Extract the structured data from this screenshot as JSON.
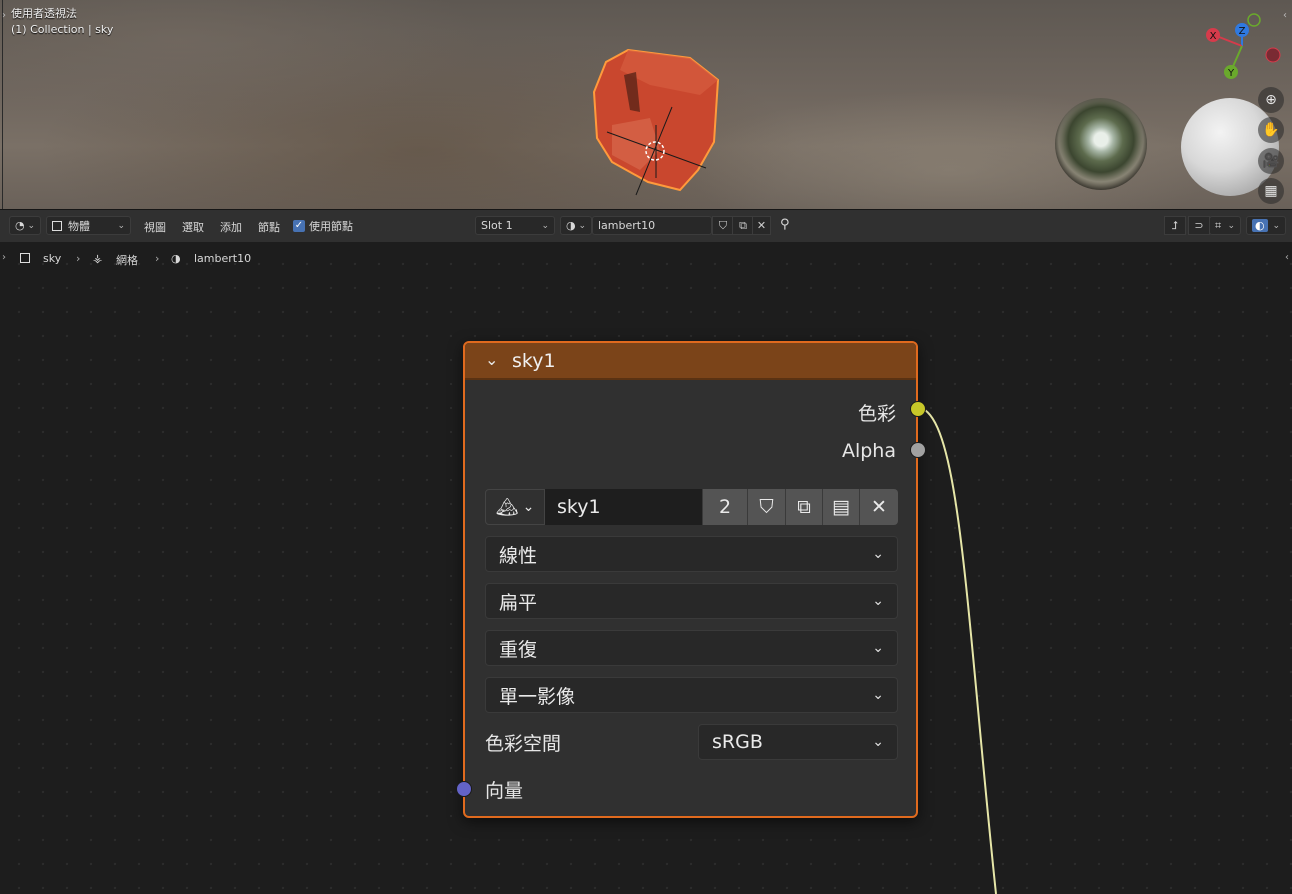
{
  "viewport": {
    "mode_label": "使用者透視法",
    "collection_label": "(1) Collection | sky",
    "gizmo_axes": [
      "X",
      "Y",
      "Z"
    ],
    "nav_icons": [
      "zoom-icon",
      "pan-hand-icon",
      "camera-icon",
      "grid-icon"
    ]
  },
  "header": {
    "editor_type_icon": "node-editor-icon",
    "object_mode": "物體",
    "menus": [
      "視圖",
      "選取",
      "添加",
      "節點"
    ],
    "use_nodes_label": "使用節點",
    "use_nodes_checked": true,
    "slot": "Slot 1",
    "material_name": "lambert10",
    "right_icons": [
      "parent-icon",
      "snap-icon",
      "overlay-icon",
      "shading-icon"
    ]
  },
  "breadcrumb": {
    "items": [
      "sky",
      "網格",
      "lambert10"
    ]
  },
  "node": {
    "title": "sky1",
    "outputs": [
      "色彩",
      "Alpha"
    ],
    "image_name": "sky1",
    "user_count": "2",
    "interpolation": "線性",
    "projection": "扁平",
    "extension": "重復",
    "source": "單一影像",
    "color_space_label": "色彩空間",
    "color_space_value": "sRGB",
    "input_label": "向量",
    "colors": {
      "header": "#7b4419",
      "outline": "#e06a1e",
      "color_socket": "#c7c729",
      "alpha_socket": "#a1a1a1",
      "vector_socket": "#6363c7",
      "link": "#e6e6a8"
    }
  }
}
